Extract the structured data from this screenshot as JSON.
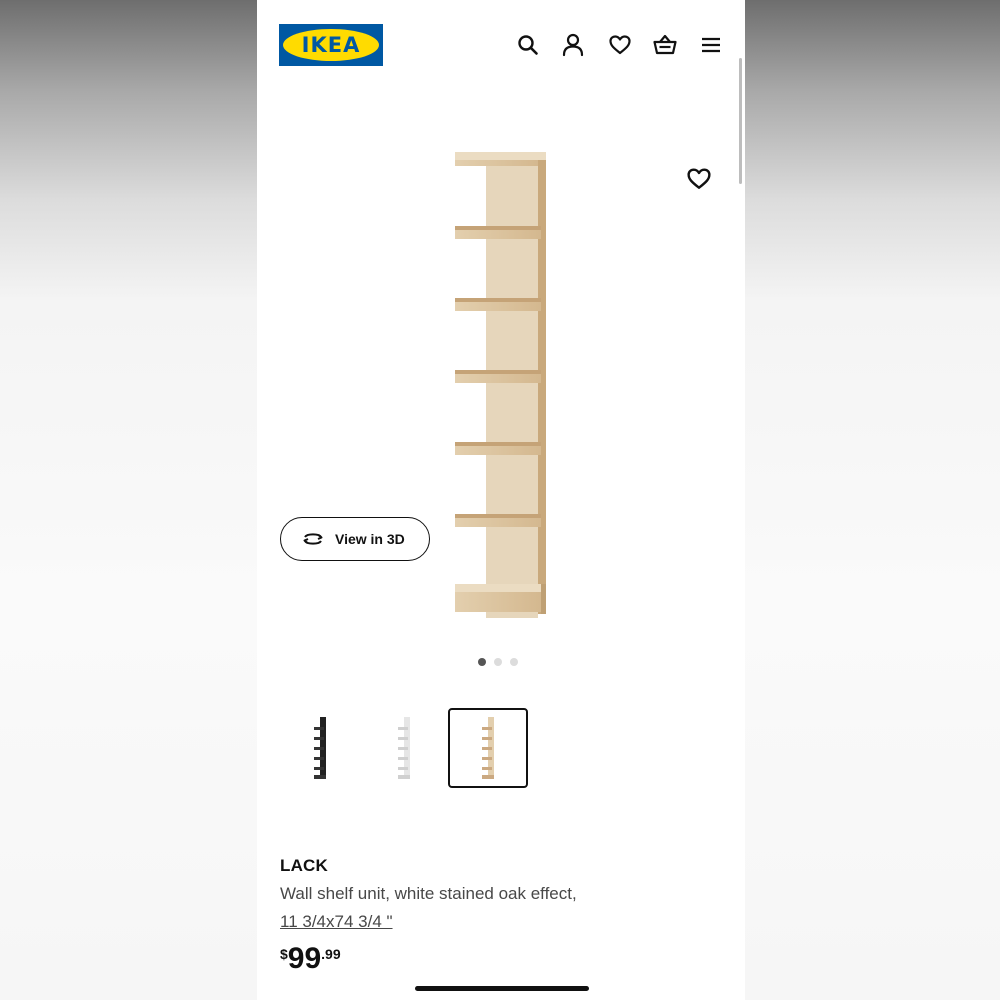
{
  "header": {
    "logo_text": "IKEA",
    "icons": [
      "search-icon",
      "account-icon",
      "heart-icon",
      "cart-icon",
      "menu-icon"
    ]
  },
  "gallery": {
    "view3d_label": "View in 3D",
    "image_count": 3,
    "active_image": 1
  },
  "variants": {
    "options": [
      "black-brown",
      "white",
      "white stained oak effect"
    ],
    "selected": 3
  },
  "product": {
    "name": "LACK",
    "description": "Wall shelf unit, white stained oak effect,",
    "size": "11 3/4x74 3/4 \"",
    "price": {
      "currency": "$",
      "whole": "99",
      "decimal": ".99"
    }
  },
  "colors": {
    "brand_blue": "#0058a3",
    "brand_yellow": "#ffdb00",
    "wood": "#d9bf9a"
  }
}
